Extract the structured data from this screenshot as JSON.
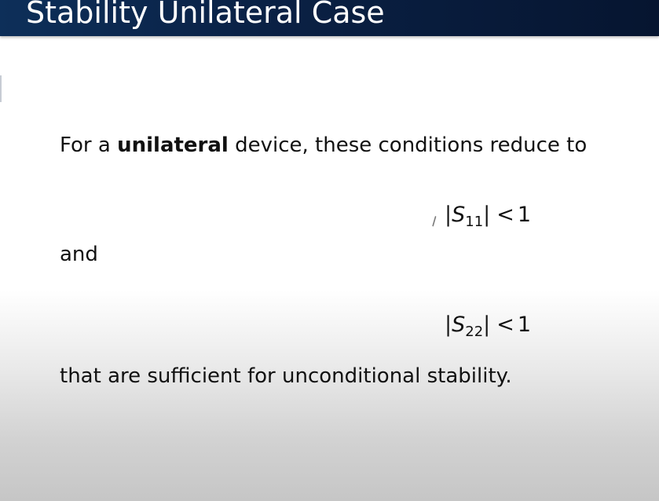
{
  "slide": {
    "title": "Stability Unilateral Case",
    "intro_before": "For a ",
    "intro_bold": "unilateral",
    "intro_after": " device, these conditions reduce to",
    "eq1": {
      "open": "|",
      "var": "S",
      "sub": "11",
      "close": "|",
      "rel": "<",
      "rhs": "1"
    },
    "and_text": "and",
    "eq2": {
      "open": "|",
      "var": "S",
      "sub": "22",
      "close": "|",
      "rel": "<",
      "rhs": "1"
    },
    "conclusion": "that are sufficient for unconditional stability."
  }
}
